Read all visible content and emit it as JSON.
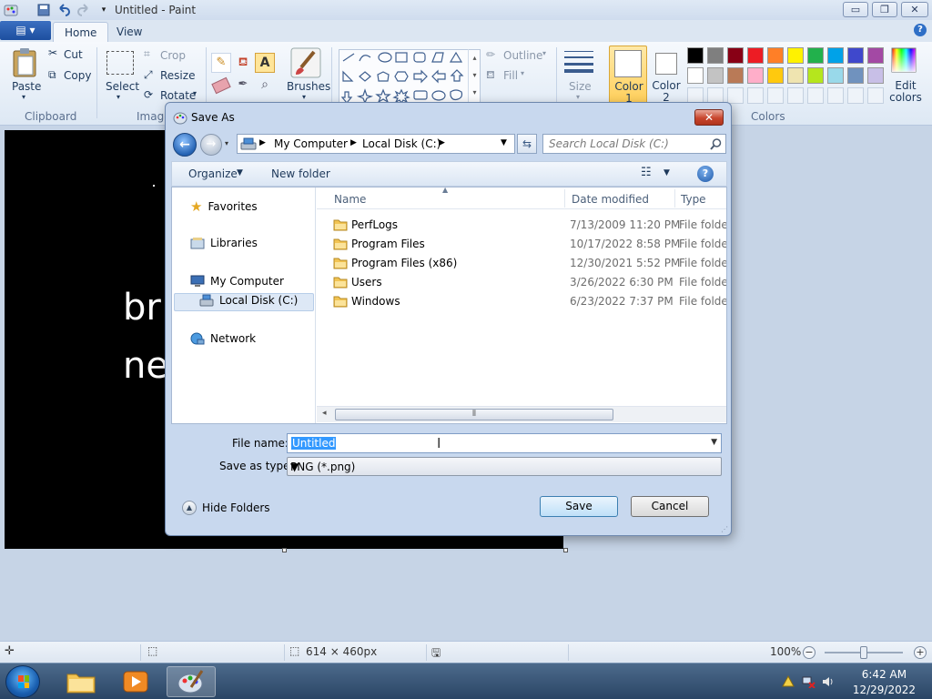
{
  "window": {
    "title": "Untitled - Paint",
    "controls": {
      "minimize": "▭",
      "restore": "❐",
      "close": "✕"
    }
  },
  "tabs": {
    "file": "▤ ▾",
    "home": "Home",
    "view": "View"
  },
  "ribbon": {
    "clipboard": {
      "label": "Clipboard",
      "paste": "Paste",
      "cut": "Cut",
      "copy": "Copy"
    },
    "image": {
      "label": "Image",
      "select": "Select",
      "crop": "Crop",
      "resize": "Resize",
      "rotate": "Rotate"
    },
    "tools": {
      "brushes": "Brushes"
    },
    "shapes": {
      "outline": "Outline",
      "fill": "Fill"
    },
    "size": "Size",
    "color1": "Color 1",
    "color2": "Color 2",
    "colors_label": "Colors",
    "edit_colors": "Edit colors",
    "palette_row1": [
      "#000000",
      "#7f7f7f",
      "#880015",
      "#ed1c24",
      "#ff7f27",
      "#fff200",
      "#22b14c",
      "#00a2e8",
      "#3f48cc",
      "#a349a4"
    ],
    "palette_row2": [
      "#ffffff",
      "#c3c3c3",
      "#b97a57",
      "#ffaec9",
      "#ffc90e",
      "#efe4b0",
      "#b5e61d",
      "#99d9ea",
      "#7092be",
      "#c8bfe7"
    ]
  },
  "canvas": {
    "text_line1": "br",
    "text_line2": "ne"
  },
  "statusbar": {
    "size": "614 × 460px",
    "zoom": "100%"
  },
  "taskbar": {
    "time": "6:42 AM",
    "date": "12/29/2022"
  },
  "dialog": {
    "title": "Save As",
    "breadcrumb": [
      "My Computer",
      "Local Disk (C:)"
    ],
    "search_placeholder": "Search Local Disk (C:)",
    "organize": "Organize",
    "new_folder": "New folder",
    "nav": {
      "favorites": "Favorites",
      "libraries": "Libraries",
      "my_computer": "My Computer",
      "local_disk": "Local Disk (C:)",
      "network": "Network"
    },
    "columns": {
      "name": "Name",
      "date": "Date modified",
      "type": "Type"
    },
    "files": [
      {
        "name": "PerfLogs",
        "date": "7/13/2009 11:20 PM",
        "type": "File folder"
      },
      {
        "name": "Program Files",
        "date": "10/17/2022 8:58 PM",
        "type": "File folder"
      },
      {
        "name": "Program Files (x86)",
        "date": "12/30/2021 5:52 PM",
        "type": "File folder"
      },
      {
        "name": "Users",
        "date": "3/26/2022 6:30 PM",
        "type": "File folder"
      },
      {
        "name": "Windows",
        "date": "6/23/2022 7:37 PM",
        "type": "File folder"
      }
    ],
    "file_name_label": "File name:",
    "file_name_value": "Untitled",
    "save_type_label": "Save as type:",
    "save_type_value": "PNG (*.png)",
    "hide_folders": "Hide Folders",
    "save": "Save",
    "cancel": "Cancel"
  }
}
